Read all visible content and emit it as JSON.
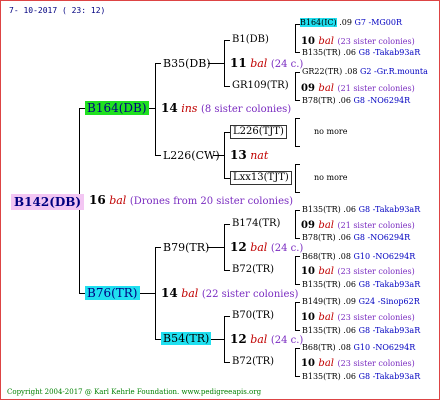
{
  "header": {
    "date": "7- 10-2017 ( 23: 12)"
  },
  "footer": {
    "copyright": "Copyright 2004-2017 @ Karl Kehrle Foundation.   www.pedigreeapis.org"
  },
  "root": {
    "name": "B142(DB)",
    "number": "16",
    "species": "bal",
    "sisters": "(Drones from 20 sister colonies)"
  },
  "gen1": [
    {
      "name": "B164(DB)",
      "number": "14",
      "species": "ins",
      "sisters": "(8 sister colonies)"
    },
    {
      "name": "B76(TR)",
      "number": "14",
      "species": "bal",
      "sisters": "(22 sister colonies)"
    }
  ],
  "gen2": [
    {
      "name": "B35(DB)",
      "number": "11",
      "species": "bal",
      "sisters": "(24 c.)"
    },
    {
      "name": "L226(CW)",
      "number": "13",
      "species": "nat"
    },
    {
      "name": "B79(TR)",
      "number": "12",
      "species": "bal",
      "sisters": "(24 c.)"
    },
    {
      "name": "B54(TR)",
      "number": "12",
      "species": "bal",
      "sisters": "(24 c.)"
    }
  ],
  "gen3": [
    {
      "name": "B1(DB)",
      "number": "10",
      "species": "bal",
      "sisters": "(23 sister colonies)"
    },
    {
      "name": "GR109(TR)",
      "number": "09",
      "species": "bal",
      "sisters": "(21 sister colonies)"
    },
    {
      "name": "L226(TJT)"
    },
    {
      "name": "Lxx13(TJT)"
    },
    {
      "name": "B174(TR)",
      "number": "09",
      "species": "bal",
      "sisters": "(21 sister colonies)"
    },
    {
      "name": "B72(TR)",
      "number": "10",
      "species": "bal",
      "sisters": "(23 sister colonies)"
    },
    {
      "name": "B70(TR)",
      "number": "10",
      "species": "bal",
      "sisters": "(23 sister colonies)"
    },
    {
      "name": "B72(TR)",
      "number": "10",
      "species": "bal",
      "sisters": "(23 sister colonies)"
    }
  ],
  "gen4": [
    {
      "name": "B164(IC)",
      "year": ".09",
      "breeder": "G7 -MG00R"
    },
    {
      "name": "B135(TR)",
      "year": ".06",
      "breeder": "G8 -Takab93aR"
    },
    {
      "name": "GR22(TR)",
      "year": ".08",
      "breeder": "G2 -Gr.R.mounta"
    },
    {
      "name": "B78(TR)",
      "year": ".06",
      "breeder": "G8 -NO6294R"
    },
    {
      "name": "B135(TR)",
      "year": ".06",
      "breeder": "G8 -Takab93aR"
    },
    {
      "name": "B78(TR)",
      "year": ".06",
      "breeder": "G8 -NO6294R"
    },
    {
      "name": "B68(TR)",
      "year": ".08",
      "breeder": "G10 -NO6294R"
    },
    {
      "name": "B135(TR)",
      "year": ".06",
      "breeder": "G8 -Takab93aR"
    },
    {
      "name": "B149(TR)",
      "year": ".09",
      "breeder": "G24 -Sinop62R"
    },
    {
      "name": "B135(TR)",
      "year": ".06",
      "breeder": "G8 -Takab93aR"
    },
    {
      "name": "B68(TR)",
      "year": ".08",
      "breeder": "G10 -NO6294R"
    },
    {
      "name": "B135(TR)",
      "year": ".06",
      "breeder": "G8 -Takab93aR"
    }
  ],
  "nomore": "no more"
}
